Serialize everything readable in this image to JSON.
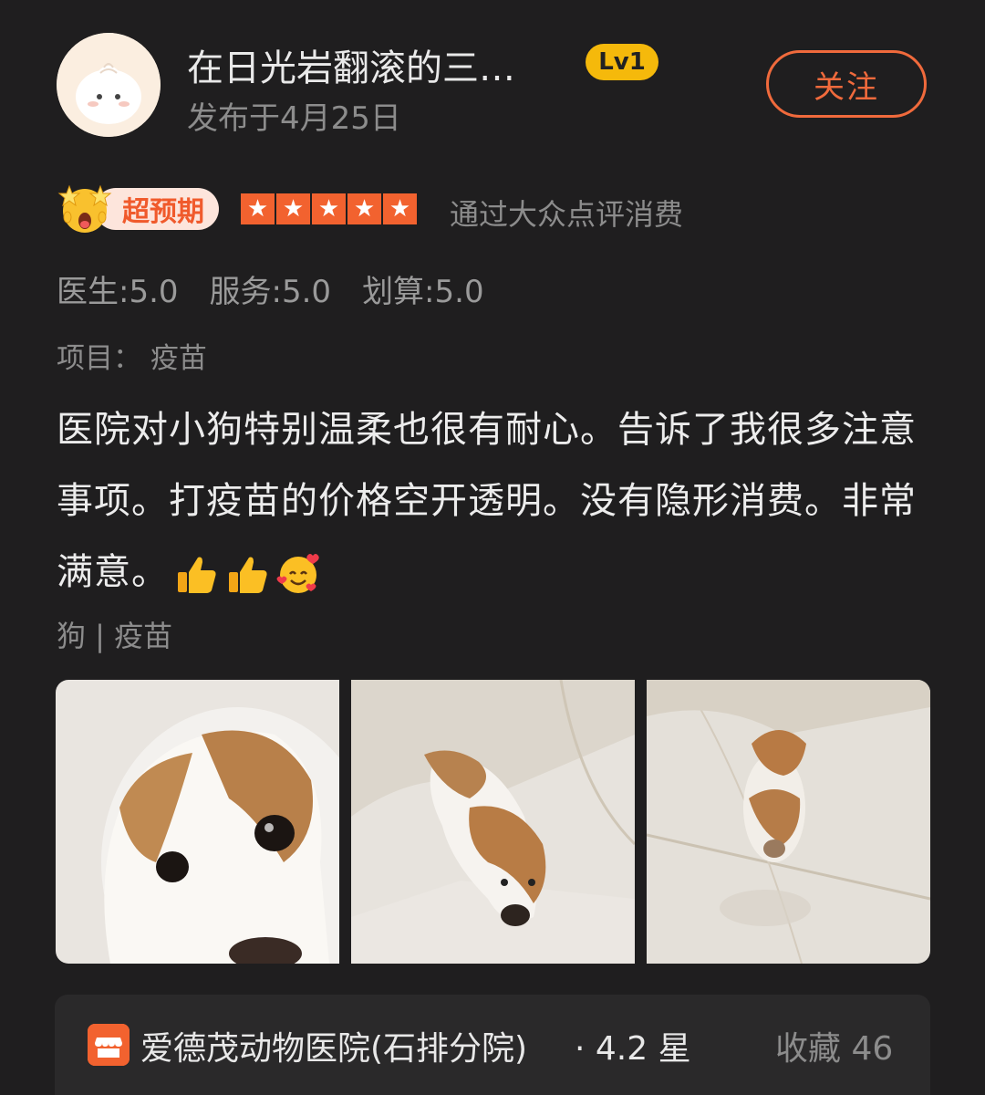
{
  "user": {
    "name": "在日光岩翻滚的三…",
    "level": "Lv1",
    "publish_date": "发布于4月25日",
    "follow_label": "关注"
  },
  "rating": {
    "badge_label": "超预期",
    "stars": 5,
    "source": "通过大众点评消费",
    "scores": [
      {
        "label": "医生:5.0"
      },
      {
        "label": "服务:5.0"
      },
      {
        "label": "划算:5.0"
      }
    ],
    "project": "项目：  疫苗"
  },
  "review": {
    "text": "医院对小狗特别温柔也很有耐心。告诉了我很多注意事项。打疫苗的价格空开透明。没有隐形消费。非常满意。",
    "emojis": [
      "thumbs-up",
      "thumbs-up",
      "smiling-face-with-hearts"
    ]
  },
  "tags": "狗 | 疫苗",
  "photos": [
    "puppy-closeup",
    "puppy-on-floor",
    "puppy-walking"
  ],
  "shop": {
    "name": "爱德茂动物医院(石排分院)",
    "rating": "·  4.2 星",
    "favorites": "收藏 46"
  },
  "colors": {
    "accent": "#f2622f",
    "level_badge": "#f5b90b",
    "background": "#1f1e1f"
  }
}
